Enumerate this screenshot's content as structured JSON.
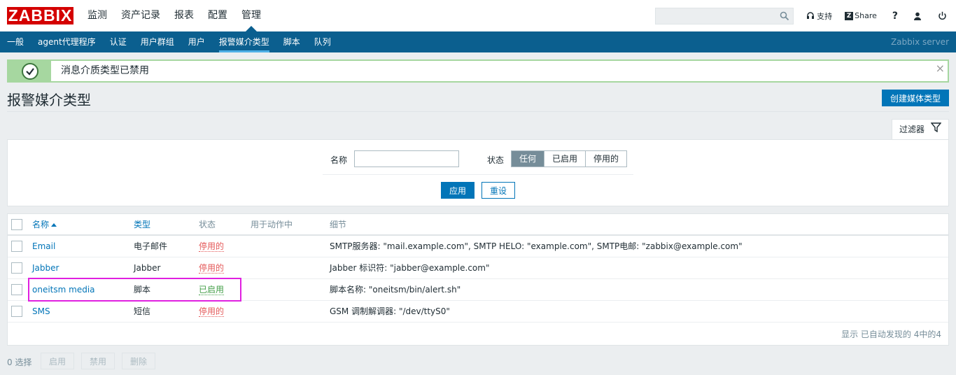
{
  "logo": "ZABBIX",
  "top_nav": [
    "监测",
    "资产记录",
    "报表",
    "配置",
    "管理"
  ],
  "top_links": {
    "support": "支持",
    "share": "Share",
    "help": "?"
  },
  "sub_nav": [
    "一般",
    "agent代理程序",
    "认证",
    "用户群组",
    "用户",
    "报警媒介类型",
    "脚本",
    "队列"
  ],
  "server_name": "Zabbix server",
  "message": {
    "text": "消息介质类型已禁用",
    "close": "×"
  },
  "page": {
    "title": "报警媒介类型",
    "create_button": "创建媒体类型"
  },
  "filter": {
    "tab_label": "过滤器",
    "name_label": "名称",
    "name_value": "",
    "status_label": "状态",
    "status_options": [
      "任何",
      "已启用",
      "停用的"
    ],
    "status_selected": "任何",
    "apply": "应用",
    "reset": "重设"
  },
  "table": {
    "headers": {
      "name": "名称",
      "type": "类型",
      "status": "状态",
      "used": "用于动作中",
      "details": "细节"
    },
    "rows": [
      {
        "name": "Email",
        "type": "电子邮件",
        "status": "停用的",
        "enabled": false,
        "details": "SMTP服务器: \"mail.example.com\", SMTP HELO: \"example.com\", SMTP电邮: \"zabbix@example.com\""
      },
      {
        "name": "Jabber",
        "type": "Jabber",
        "status": "停用的",
        "enabled": false,
        "details": "Jabber 标识符: \"jabber@example.com\""
      },
      {
        "name": "oneitsm media",
        "type": "脚本",
        "status": "已启用",
        "enabled": true,
        "details": "脚本名称: \"oneitsm/bin/alert.sh\""
      },
      {
        "name": "SMS",
        "type": "短信",
        "status": "停用的",
        "enabled": false,
        "details": "GSM 调制解调器: \"/dev/ttyS0\""
      }
    ],
    "paging": "显示 已自动发现的 4中的4"
  },
  "footer": {
    "selected": "0 选择",
    "enable": "启用",
    "disable": "禁用",
    "delete": "删除"
  },
  "colors": {
    "brand": "#d40000",
    "subnav": "#0b5f8f",
    "accent": "#0275b8",
    "success": "#a6d7a0",
    "disabled": "#e45959",
    "enabled": "#429e47",
    "highlight": "#e020e0"
  }
}
